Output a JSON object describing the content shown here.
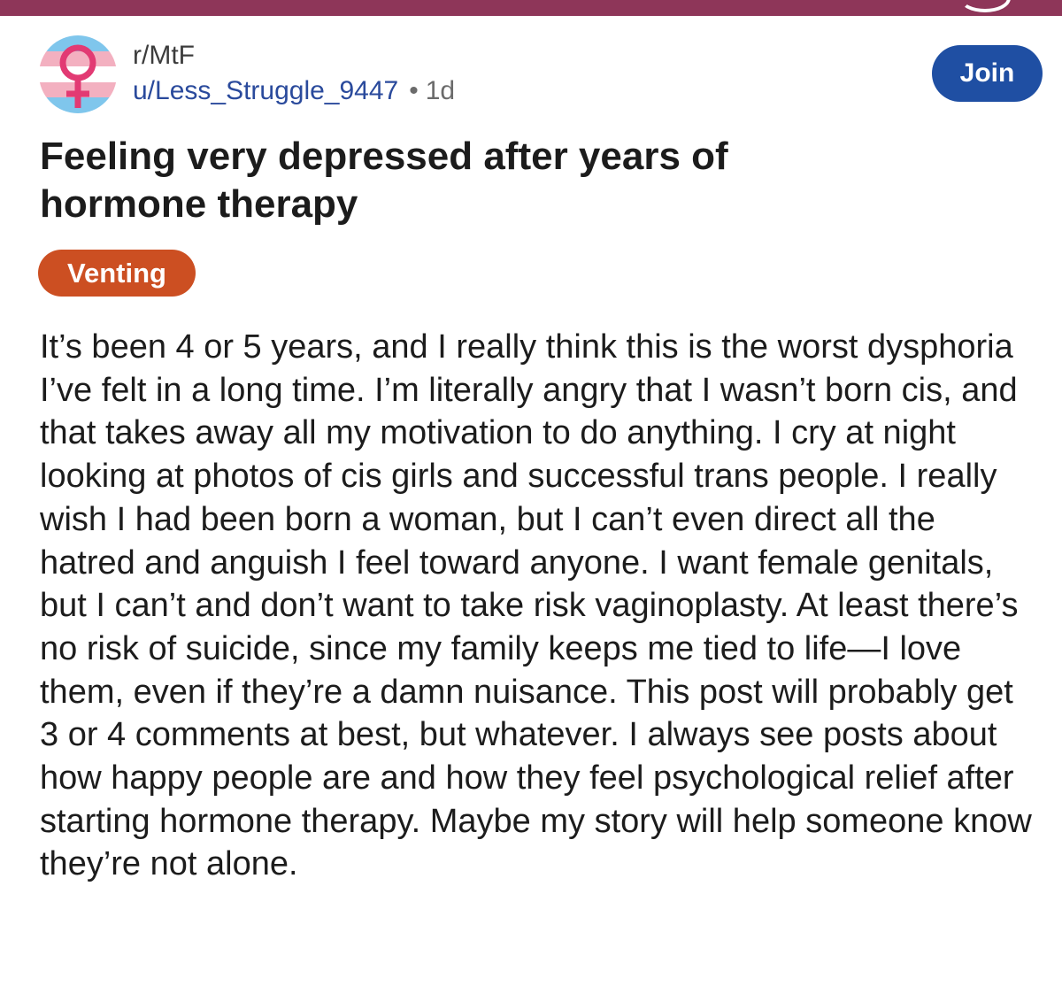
{
  "post": {
    "subreddit": "r/MtF",
    "username": "u/Less_Struggle_9447",
    "separator": "•",
    "age": "1d",
    "join_label": "Join",
    "title": "Feeling very depressed after years of hormone therapy",
    "flair": "Venting",
    "body": "It’s been 4 or 5 years, and I really think this is the worst dysphoria I’ve felt in a long time. I’m literally angry that I wasn’t born cis, and that takes away all my motivation to do anything. I cry at night looking at photos of cis girls and successful trans people. I really wish I had been born a woman, but I can’t even direct all the hatred and anguish I feel toward anyone. I want female genitals, but I can’t and don’t want to take risk vaginoplasty. At least there’s no risk of suicide, since my family keeps me tied to life—I love them, even if they’re a damn nuisance. This post will probably get 3 or 4 comments at best, but whatever. I always see posts about how happy people are and how they feel psychological relief after starting hormone therapy. Maybe my story will help someone know they’re not alone."
  },
  "avatar_icon": "trans-flag-female-symbol-icon",
  "colors": {
    "top_bar": "#8e3659",
    "join_button": "#1f4fa3",
    "flair": "#cc4f22",
    "username": "#2a4a9c",
    "flag_blue": "#7fc6ec",
    "flag_pink": "#f3b0c0",
    "flag_white": "#ffffff"
  }
}
